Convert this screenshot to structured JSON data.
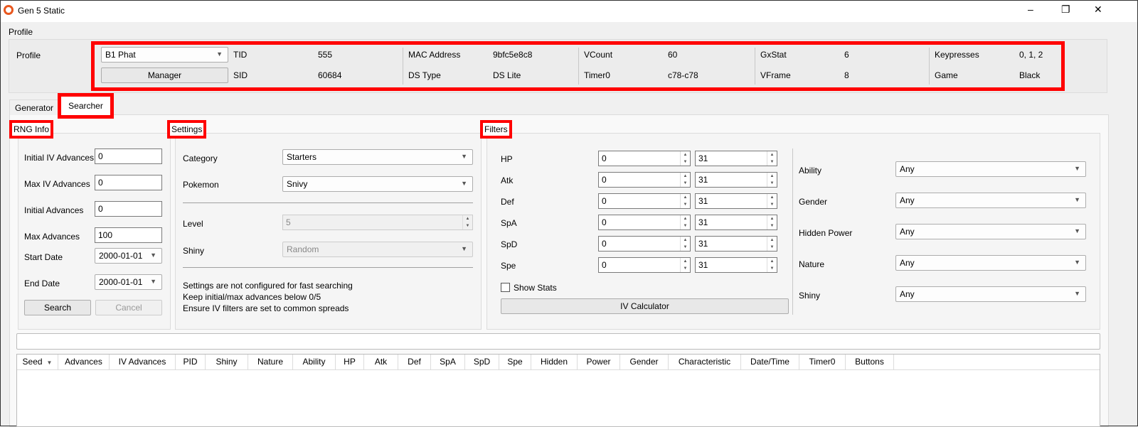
{
  "window": {
    "title": "Gen 5 Static",
    "minimize": "–",
    "restore": "❐",
    "close": "✕"
  },
  "profile": {
    "group_title": "Profile",
    "label": "Profile",
    "selected": "B1 Phat",
    "manager": "Manager",
    "fields": [
      {
        "label": "TID",
        "value": "555"
      },
      {
        "label": "SID",
        "value": "60684"
      },
      {
        "label": "MAC Address",
        "value": "9bfc5e8c8"
      },
      {
        "label": "DS Type",
        "value": "DS Lite"
      },
      {
        "label": "VCount",
        "value": "60"
      },
      {
        "label": "Timer0",
        "value": "c78-c78"
      },
      {
        "label": "GxStat",
        "value": "6"
      },
      {
        "label": "VFrame",
        "value": "8"
      },
      {
        "label": "Keypresses",
        "value": "0, 1, 2"
      },
      {
        "label": "Game",
        "value": "Black"
      }
    ]
  },
  "tabs": [
    {
      "label": "Generator"
    },
    {
      "label": "Searcher",
      "active": true
    }
  ],
  "rng": {
    "title": "RNG Info",
    "fields": [
      {
        "label": "Initial IV Advances",
        "value": "0"
      },
      {
        "label": "Max IV Advances",
        "value": "0"
      },
      {
        "label": "Initial Advances",
        "value": "0"
      },
      {
        "label": "Max Advances",
        "value": "100"
      }
    ],
    "start_date_label": "Start Date",
    "start_date": "2000-01-01",
    "end_date_label": "End Date",
    "end_date": "2000-01-01",
    "search": "Search",
    "cancel": "Cancel"
  },
  "settings": {
    "title": "Settings",
    "category_label": "Category",
    "category": "Starters",
    "pokemon_label": "Pokemon",
    "pokemon": "Snivy",
    "level_label": "Level",
    "level": "5",
    "shiny_label": "Shiny",
    "shiny": "Random",
    "notes": [
      "Settings are not configured for fast searching",
      "Keep initial/max advances below 0/5",
      "Ensure IV filters are set to common spreads"
    ]
  },
  "filters": {
    "title": "Filters",
    "ivs": [
      {
        "label": "HP",
        "min": "0",
        "max": "31"
      },
      {
        "label": "Atk",
        "min": "0",
        "max": "31"
      },
      {
        "label": "Def",
        "min": "0",
        "max": "31"
      },
      {
        "label": "SpA",
        "min": "0",
        "max": "31"
      },
      {
        "label": "SpD",
        "min": "0",
        "max": "31"
      },
      {
        "label": "Spe",
        "min": "0",
        "max": "31"
      }
    ],
    "show_stats": "Show Stats",
    "iv_calculator": "IV Calculator",
    "dropdowns": [
      {
        "label": "Ability",
        "value": "Any"
      },
      {
        "label": "Gender",
        "value": "Any"
      },
      {
        "label": "Hidden Power",
        "value": "Any"
      },
      {
        "label": "Nature",
        "value": "Any"
      },
      {
        "label": "Shiny",
        "value": "Any"
      }
    ]
  },
  "table": {
    "columns": [
      "Seed",
      "Advances",
      "IV Advances",
      "PID",
      "Shiny",
      "Nature",
      "Ability",
      "HP",
      "Atk",
      "Def",
      "SpA",
      "SpD",
      "Spe",
      "Hidden",
      "Power",
      "Gender",
      "Characteristic",
      "Date/Time",
      "Timer0",
      "Buttons"
    ]
  },
  "colors": {
    "highlight": "#ff0000"
  }
}
